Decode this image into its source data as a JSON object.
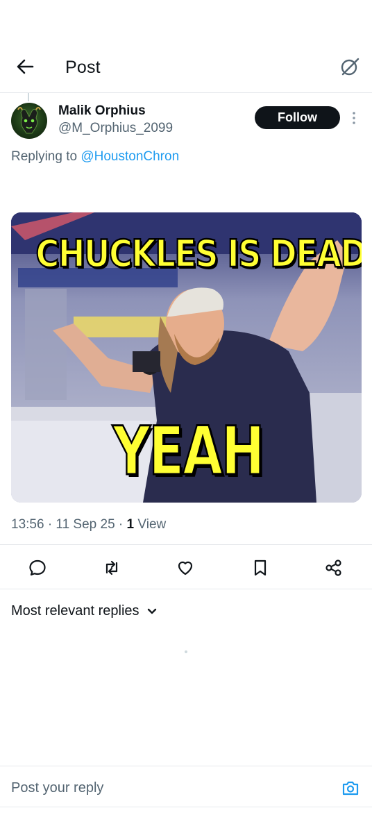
{
  "header": {
    "title": "Post",
    "back_icon": "arrow-left-icon",
    "grok_icon": "grok-icon"
  },
  "author": {
    "name": "Malik Orphius",
    "handle": "@M_Orphius_2099",
    "follow_label": "Follow",
    "more_icon": "more-vertical-icon"
  },
  "reply_context": {
    "prefix": "Replying to ",
    "mention": "@HoustonChron"
  },
  "media": {
    "top_text": "CHUCKLES IS DEAD",
    "bottom_text": "YEAH"
  },
  "meta": {
    "timestamp": "13:56 · 11 Sep 25 · ",
    "views_count": "1",
    "views_label": " View"
  },
  "actions": [
    {
      "name": "reply-icon"
    },
    {
      "name": "repost-icon"
    },
    {
      "name": "like-icon"
    },
    {
      "name": "bookmark-icon"
    },
    {
      "name": "share-icon"
    }
  ],
  "replies": {
    "sort_label": "Most relevant replies"
  },
  "composer": {
    "placeholder": "Post your reply",
    "camera_icon": "camera-icon"
  },
  "colors": {
    "accent": "#1d9bf0",
    "text_primary": "#0f1419",
    "text_secondary": "#536471",
    "meme_text": "#ffff33"
  }
}
